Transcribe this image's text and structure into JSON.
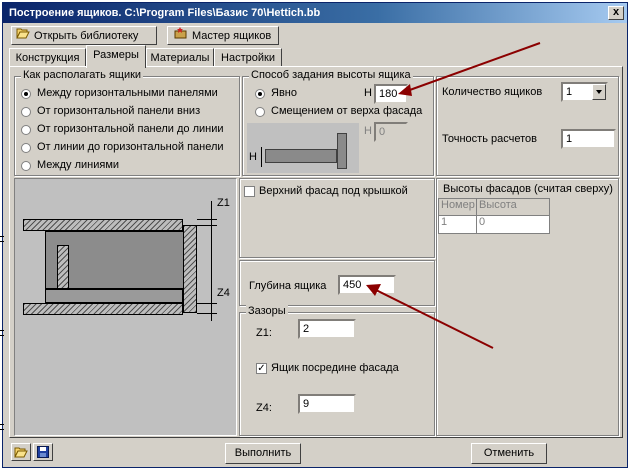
{
  "window": {
    "title": "Построение ящиков.  C:\\Program Files\\Базис 70\\Hettich.bb",
    "close_glyph": "x"
  },
  "toolbar": {
    "open_library": "Открыть библиотеку",
    "wizard": "Мастер ящиков"
  },
  "tabs": [
    "Конструкция",
    "Размеры",
    "Материалы",
    "Настройки"
  ],
  "placement": {
    "title": "Как располагать ящики",
    "options": [
      "Между горизонтальными панелями",
      "От горизонтальной панели вниз",
      "От горизонтальной панели до линии",
      "От линии до горизонтальной панели",
      "Между линиями"
    ],
    "selected": 0
  },
  "height_mode": {
    "title": "Способ задания высоты ящика",
    "explicit_label": "Явно",
    "offset_label": "Смещением от верха фасада",
    "h_label": "H",
    "h_value": "180",
    "h2_value": "0",
    "diagram_label": "H"
  },
  "count": {
    "label": "Количество ящиков",
    "value": "1"
  },
  "precision": {
    "label": "Точность расчетов",
    "value": "1"
  },
  "diagram": {
    "z1": "Z1",
    "z4": "Z4"
  },
  "top_facade": {
    "label": "Верхний фасад под  крышкой",
    "checked": false
  },
  "depth": {
    "label": "Глубина ящика",
    "value": "450"
  },
  "gaps": {
    "title": "Зазоры",
    "z1_label": "Z1:",
    "z1_value": "2",
    "middle_label": "Ящик посредине фасада",
    "middle_checked": true,
    "z4_label": "Z4:",
    "z4_value": "9"
  },
  "facades": {
    "title": "Высоты фасадов (считая сверху)",
    "columns": [
      "Номер",
      "Высота"
    ],
    "rows": [
      [
        "1",
        "0"
      ]
    ]
  },
  "buttons": {
    "run": "Выполнить",
    "cancel": "Отменить"
  },
  "colors": {
    "title_start": "#0a246a",
    "face": "#d4d0c8",
    "arrow": "#8b0000"
  }
}
